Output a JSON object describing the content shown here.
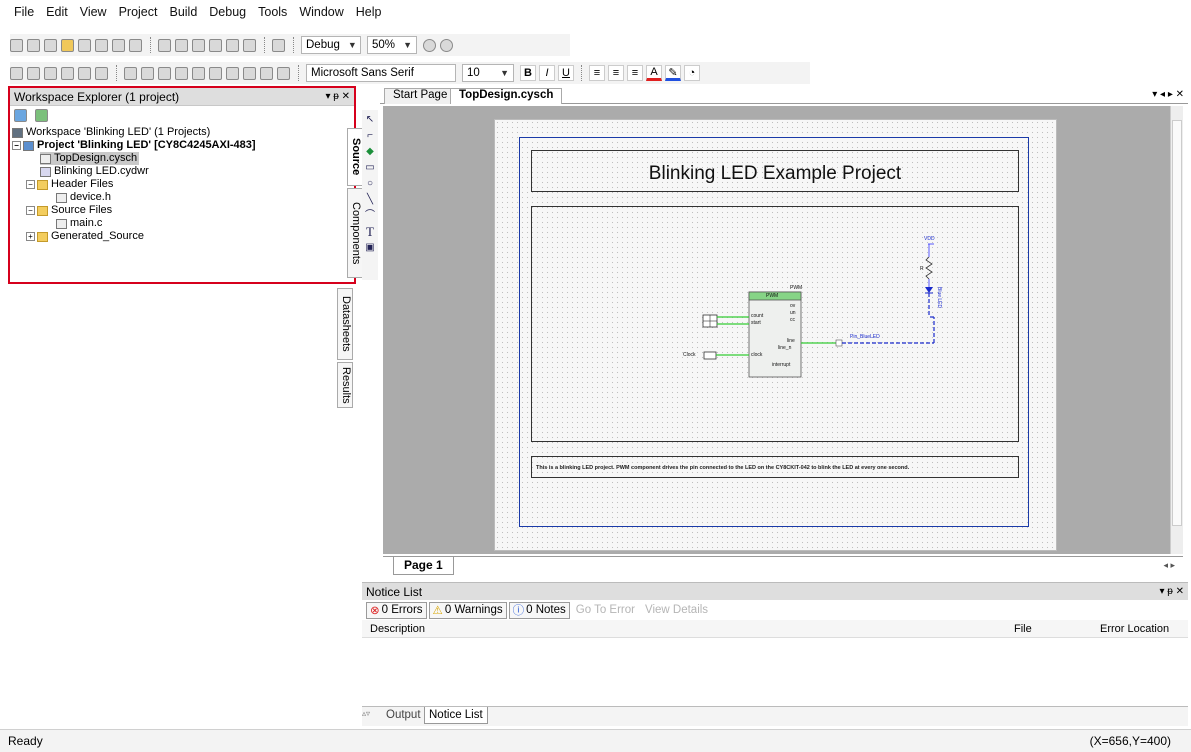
{
  "menu": [
    "File",
    "Edit",
    "View",
    "Project",
    "Build",
    "Debug",
    "Tools",
    "Window",
    "Help"
  ],
  "toolbar": {
    "config": "Debug",
    "zoom": "50%",
    "font": "Microsoft Sans Serif",
    "font_size": "10",
    "bold": "B",
    "italic": "I",
    "underline": "U"
  },
  "workspace": {
    "title": "Workspace Explorer (1 project)",
    "controls": "▾ ᵽ ✕",
    "tree": {
      "root": "Workspace 'Blinking LED' (1 Projects)",
      "project": "Project 'Blinking LED' [CY8C4245AXI-483]",
      "topdesign": "TopDesign.cysch",
      "cydwr": "Blinking LED.cydwr",
      "header_files": "Header Files",
      "device_h": "device.h",
      "source_files": "Source Files",
      "main_c": "main.c",
      "generated": "Generated_Source"
    },
    "vtabs": [
      "Source",
      "Components",
      "Datasheets",
      "Results"
    ]
  },
  "doc": {
    "tab_start": "Start Page",
    "tab_active": "TopDesign.cysch",
    "controls": "▾ ◂ ▸ ✕"
  },
  "schematic": {
    "title": "Blinking LED Example Project",
    "description": "This is a blinking LED project. PWM component drives the pin connected to the LED on the CY8CKIT-042 to blink the LED at every one second.",
    "pwm_name": "PWM",
    "pwm_type": "PWM",
    "pins_in": [
      "count",
      "start"
    ],
    "pin_clock": "clock",
    "pins_out": [
      "ov",
      "un",
      "cc"
    ],
    "pins_line": [
      "line",
      "line_n"
    ],
    "pin_interrupt": "interrupt",
    "clock_label": "Clock",
    "net_label": "Pin_BlueLED",
    "vdd": "VDD",
    "resistor": "R",
    "led": "Blue LED"
  },
  "page_tab": "Page 1",
  "notice": {
    "title": "Notice List",
    "controls": "▾ ᵽ ✕",
    "errors": "0 Errors",
    "warnings": "0 Warnings",
    "notes": "0 Notes",
    "goto_error": "Go To Error",
    "view_details": "View Details",
    "col_description": "Description",
    "col_file": "File",
    "col_location": "Error Location"
  },
  "output_tabs": [
    "Output",
    "Notice List"
  ],
  "status": {
    "text": "Ready",
    "coords": "(X=656,Y=400)"
  }
}
